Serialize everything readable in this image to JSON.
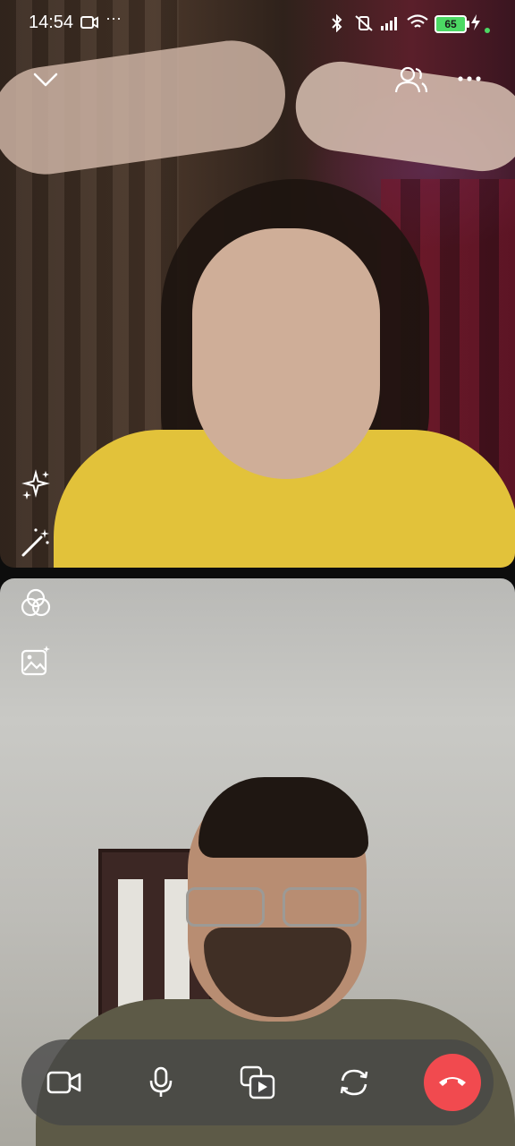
{
  "status_bar": {
    "time": "14:54",
    "battery_level": "65",
    "icons": [
      "video-icon",
      "more-dots-icon",
      "bluetooth-icon",
      "vibrate-icon",
      "signal-icon",
      "wifi-icon",
      "battery-icon",
      "charging-icon"
    ]
  },
  "remote_video": {
    "top_controls": [
      "collapse-chevron-icon",
      "participants-icon",
      "more-options-icon"
    ],
    "side_controls": [
      "effects-sparkle-icon",
      "magic-wand-icon"
    ]
  },
  "local_video": {
    "side_controls": [
      "filters-icon",
      "background-image-icon"
    ]
  },
  "call_bar": {
    "buttons": [
      "camera-icon",
      "microphone-icon",
      "share-screen-icon",
      "flip-camera-icon",
      "end-call-icon"
    ]
  },
  "colors": {
    "end_call": "#f14a4f",
    "battery": "#4cd964",
    "call_bar_bg": "#464646"
  }
}
